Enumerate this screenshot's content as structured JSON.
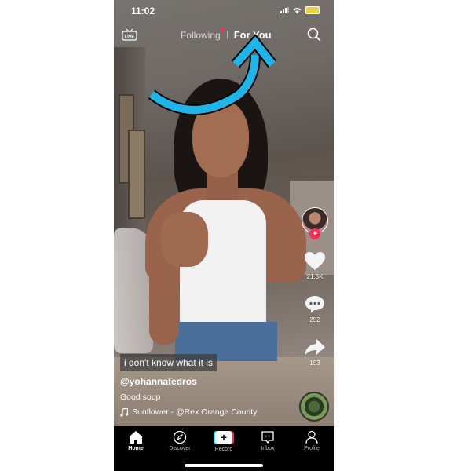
{
  "status_bar": {
    "time": "11:02"
  },
  "top_nav": {
    "live_label": "LIVE",
    "tabs": [
      {
        "label": "Following",
        "active": false,
        "has_notification_dot": true
      },
      {
        "label": "For You",
        "active": true
      }
    ]
  },
  "annotation": {
    "type": "curved-arrow",
    "color": "#1eb6e8",
    "points_to": "For You"
  },
  "sidebar": {
    "follow_label": "+",
    "likes": "21.3K",
    "comments": "252",
    "shares": "153"
  },
  "video": {
    "caption_overlay": "i don't know what it is",
    "username": "@yohannatedros",
    "description": "Good soup",
    "sound": "Sunflower - @Rex Orange County"
  },
  "bottom_nav": {
    "items": [
      {
        "label": "Home",
        "icon": "home-icon",
        "active": true
      },
      {
        "label": "Discover",
        "icon": "compass-icon",
        "active": false
      },
      {
        "label": "Record",
        "icon": "plus-icon",
        "active": false
      },
      {
        "label": "Inbox",
        "icon": "inbox-icon",
        "active": false
      },
      {
        "label": "Profile",
        "icon": "profile-icon",
        "active": false
      }
    ]
  },
  "colors": {
    "accent_red": "#fe2c55",
    "accent_cyan": "#25f4ee",
    "arrow_blue": "#1eb6e8"
  }
}
